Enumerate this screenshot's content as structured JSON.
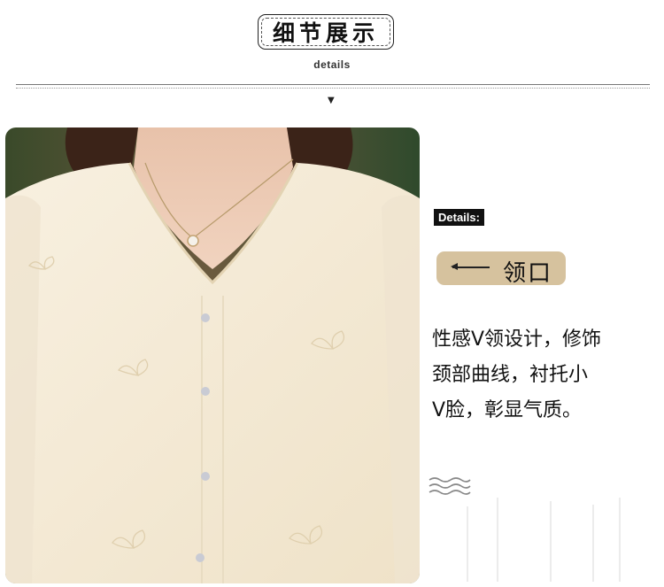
{
  "header": {
    "title": "细节展示",
    "subtitle": "details"
  },
  "detail_panel": {
    "tag": "Details:",
    "feature": "领口",
    "description_lines": [
      "性感V领设计，修饰",
      "颈部曲线，衬托小",
      "V脸，彰显气质。"
    ]
  },
  "icons": {
    "divider_arrow": "down-triangle-icon",
    "pill_arrow": "left-arrow-icon",
    "waves": "wave-lines-icon"
  },
  "colors": {
    "pill_background": "#d6c29e",
    "tag_background": "#111111",
    "blouse": "#f6eddc"
  }
}
